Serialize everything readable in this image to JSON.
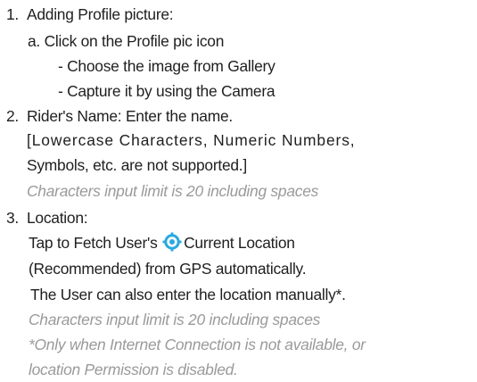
{
  "items": [
    {
      "number": "1.",
      "title": "Adding Profile picture:",
      "sub": "a. Click on the Profile pic icon",
      "bullets": [
        "-  Choose the image from Gallery",
        "-  Capture it by using the Camera"
      ]
    },
    {
      "number": "2.",
      "title": "Rider's Name: Enter the name.",
      "note_line1": "[Lowercase Characters, Numeric Numbers,",
      "note_line2": "Symbols, etc. are not supported.]",
      "limit": "Characters input limit is 20 including spaces"
    },
    {
      "number": "3.",
      "title": "Location:",
      "tap_prefix": "Tap to Fetch User's",
      "tap_suffix": "Current Location",
      "recommended": "(Recommended) from GPS automatically.",
      "manual": "The User can also enter the location manually*.",
      "limit": "Characters input limit is 20 including spaces",
      "footnote_line1": "*Only when Internet Connection is not available, or",
      "footnote_line2": "location Permission is disabled."
    }
  ],
  "icons": {
    "location": "gps-target-icon"
  },
  "colors": {
    "text": "#1f1f1f",
    "muted": "#9a9a9a",
    "icon": "#29a9e0"
  }
}
